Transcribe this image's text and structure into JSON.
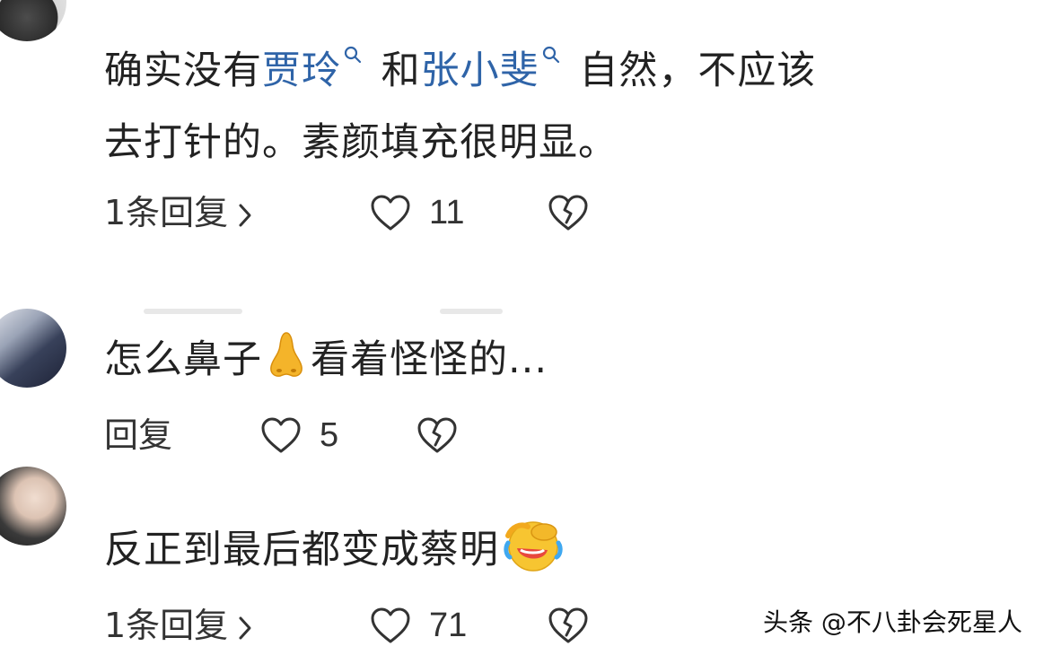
{
  "comments": [
    {
      "text_part1": "确实没有",
      "mention1": "贾玲",
      "text_part2": "和",
      "mention2": "张小斐",
      "line1_end": "自然，不应该",
      "line2": "去打针的。素颜填充很明显。",
      "reply_label": "1条回复",
      "like_count": "11"
    },
    {
      "text": "怎么鼻子",
      "emoji": "nose-emoji",
      "text_after": "看着怪怪的...",
      "reply_label": "回复",
      "like_count": "5"
    },
    {
      "text": "反正到最后都变成蔡明",
      "emoji": "rolling-laughing-emoji",
      "reply_label": "1条回复",
      "like_count": "71"
    }
  ],
  "watermark": "头条 @不八卦会死星人",
  "colors": {
    "mention": "#2f64a8",
    "text": "#222222",
    "icon": "#333333"
  }
}
